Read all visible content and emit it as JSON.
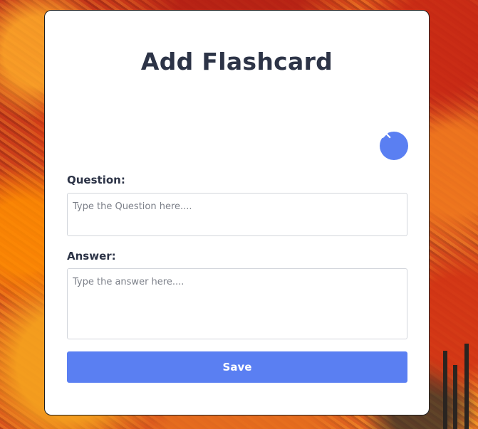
{
  "form": {
    "title": "Add Flashcard",
    "close_symbol": "✕",
    "question": {
      "label": "Question:",
      "value": "",
      "placeholder": "Type the Question here...."
    },
    "answer": {
      "label": "Answer:",
      "value": "",
      "placeholder": "Type the answer here...."
    },
    "save_label": "Save"
  },
  "colors": {
    "accent": "#5a7ff2",
    "title_text": "#2d3447",
    "card_background": "#ffffff"
  },
  "icons": {
    "close": "close-icon"
  }
}
